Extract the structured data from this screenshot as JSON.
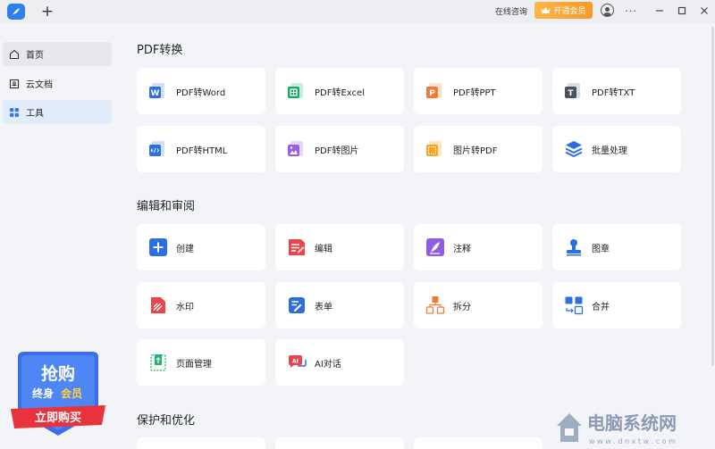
{
  "titlebar": {
    "consult_label": "在线咨询",
    "vip_label": "开通会员",
    "more_label": "···",
    "minimize_label": "—",
    "close_label": "✕",
    "new_tab_label": "+"
  },
  "sidebar": {
    "items": [
      {
        "label": "首页"
      },
      {
        "label": "云文档"
      },
      {
        "label": "工具"
      }
    ]
  },
  "sections": {
    "pdf": {
      "title": "PDF转换",
      "cards": [
        {
          "label": "PDF转Word",
          "icon": "word-icon"
        },
        {
          "label": "PDF转Excel",
          "icon": "excel-icon"
        },
        {
          "label": "PDF转PPT",
          "icon": "ppt-icon"
        },
        {
          "label": "PDF转TXT",
          "icon": "txt-icon"
        },
        {
          "label": "PDF转HTML",
          "icon": "html-icon"
        },
        {
          "label": "PDF转图片",
          "icon": "image-icon"
        },
        {
          "label": "图片转PDF",
          "icon": "image-to-pdf-icon"
        },
        {
          "label": "批量处理",
          "icon": "layers-icon"
        }
      ]
    },
    "edit": {
      "title": "编辑和审阅",
      "cards": [
        {
          "label": "创建",
          "icon": "plus-icon"
        },
        {
          "label": "编辑",
          "icon": "edit-doc-icon"
        },
        {
          "label": "注释",
          "icon": "feather-icon"
        },
        {
          "label": "图章",
          "icon": "stamp-icon"
        },
        {
          "label": "水印",
          "icon": "watermark-icon"
        },
        {
          "label": "表单",
          "icon": "form-icon"
        },
        {
          "label": "拆分",
          "icon": "split-icon"
        },
        {
          "label": "合并",
          "icon": "merge-icon"
        },
        {
          "label": "页面管理",
          "icon": "page-manage-icon"
        },
        {
          "label": "AI对话",
          "icon": "ai-chat-icon"
        }
      ]
    },
    "protect": {
      "title": "保护和优化"
    }
  },
  "promo": {
    "line1": "抢购",
    "line2a": "终身",
    "line2b": "会员",
    "line3": "立即购买"
  },
  "watermark": {
    "title": "电脑系统网",
    "url": "w w w . d n x t w . c o m"
  },
  "colors": {
    "accent": "#2f80ed",
    "vip_orange": "#f59a27",
    "active_bg": "#e3ecfb"
  }
}
